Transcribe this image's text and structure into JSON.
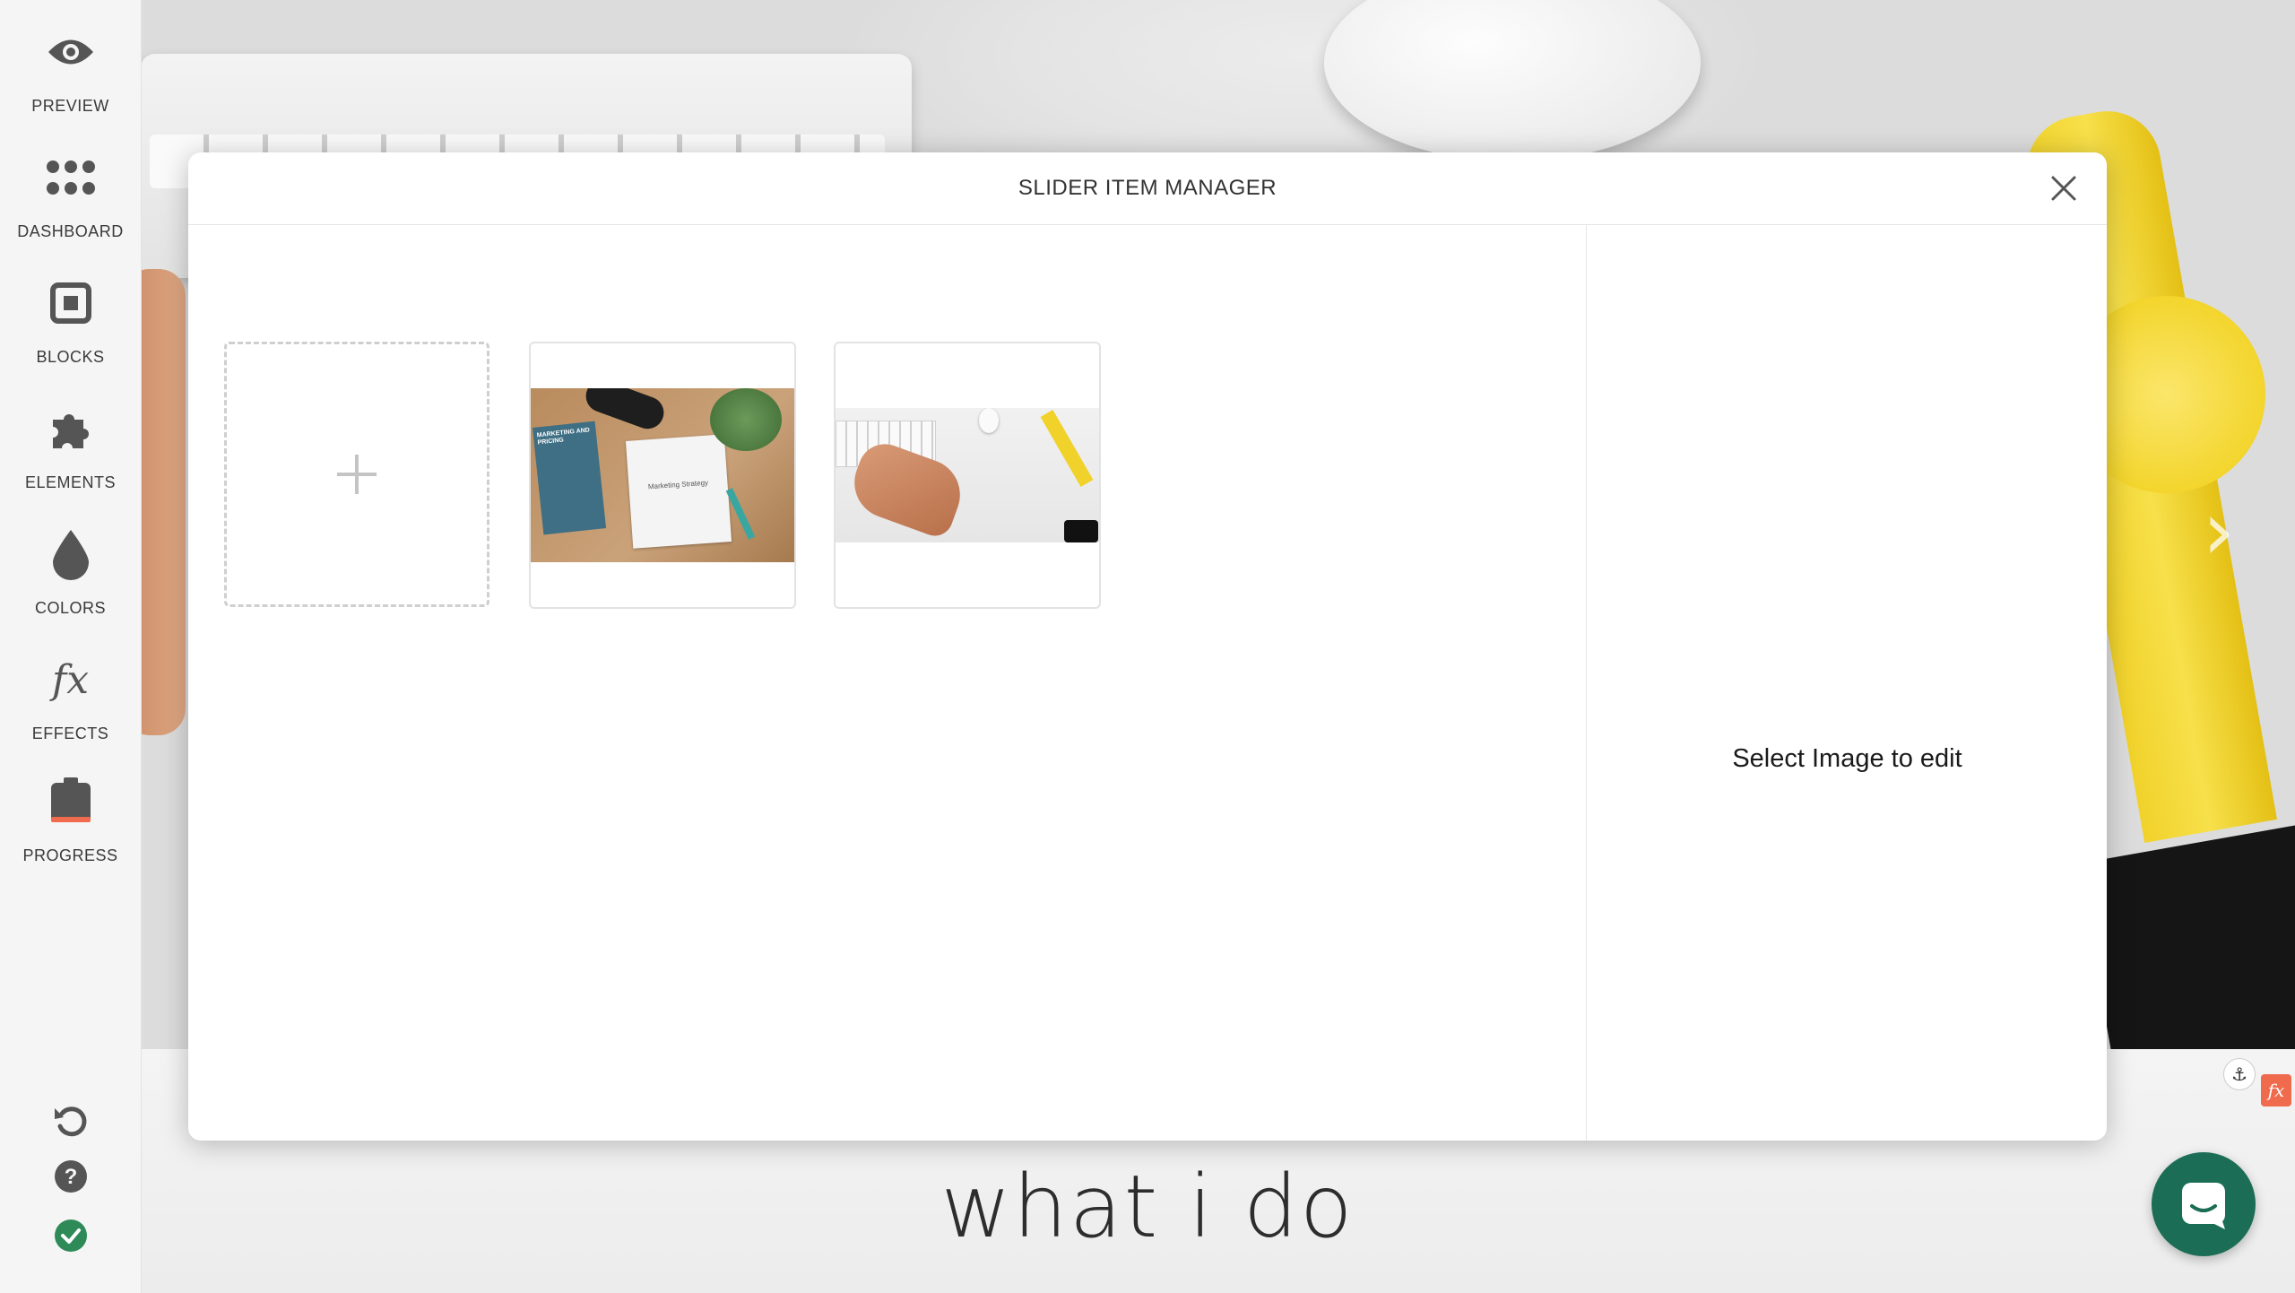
{
  "sidebar": {
    "items": [
      {
        "label": "PREVIEW",
        "icon": "eye-icon"
      },
      {
        "label": "DASHBOARD",
        "icon": "grid-dots-icon"
      },
      {
        "label": "BLOCKS",
        "icon": "block-square-icon"
      },
      {
        "label": "ELEMENTS",
        "icon": "puzzle-icon"
      },
      {
        "label": "COLORS",
        "icon": "drop-icon"
      },
      {
        "label": "EFFECTS",
        "icon": "fx-icon"
      },
      {
        "label": "PROGRESS",
        "icon": "clipboard-progress-icon"
      }
    ],
    "bottom": [
      {
        "icon": "undo-icon"
      },
      {
        "icon": "help-icon"
      },
      {
        "icon": "check-circle-icon"
      }
    ]
  },
  "modal": {
    "title": "SLIDER ITEM MANAGER",
    "close_icon": "close-icon",
    "add_icon": "plus-icon",
    "edit_hint": "Select Image to edit",
    "images": [
      {
        "alt": "desk with marketing book and notebook"
      },
      {
        "alt": "hands typing on keyboard with yellow watch"
      }
    ],
    "thumb1_note": "Marketing Strategy",
    "thumb1_book": "MARKETING AND PRICING"
  },
  "page": {
    "section_heading": "what i do",
    "fx_badge": "fx",
    "anchor_icon": "anchor-icon",
    "chat_icon": "chat-icon"
  },
  "colors": {
    "accent_green": "#1b6e55",
    "check_green": "#2e8b57",
    "fx_orange": "#f06a4e"
  }
}
